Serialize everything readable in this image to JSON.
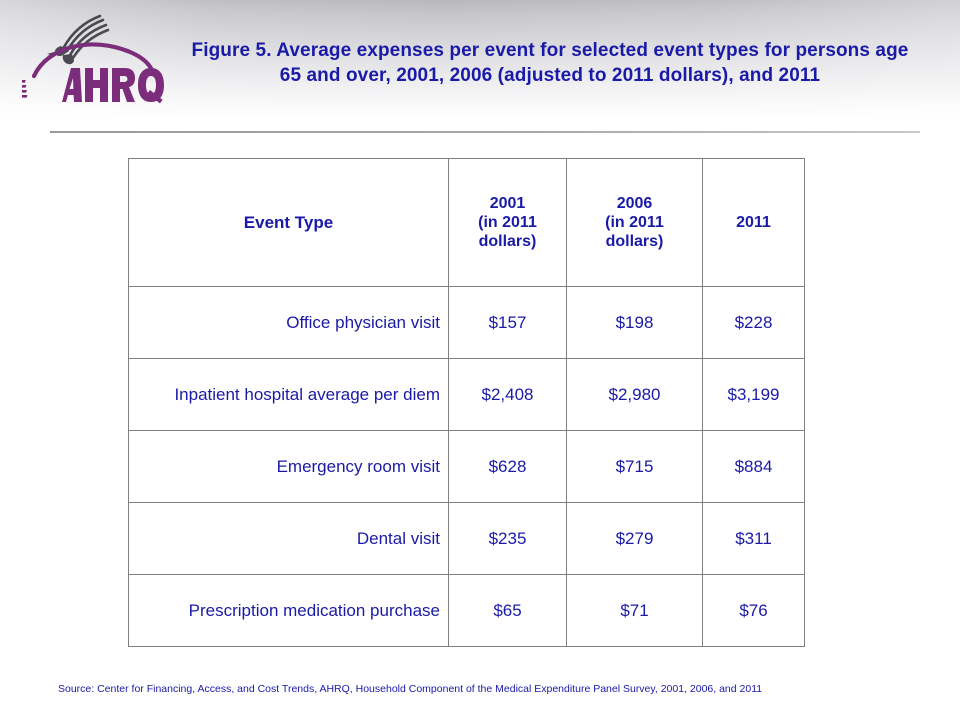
{
  "slide": {
    "title": "Figure 5. Average expenses per event for selected event types for persons age 65 and over, 2001, 2006 (adjusted to 2011 dollars), and 2011",
    "source": "Source: Center for Financing, Access, and Cost Trends, AHRQ, Household Component of the Medical Expenditure Panel Survey,  2001, 2006, and 2011",
    "colors": {
      "title_blue": "#1a1aa8",
      "logo_purple": "#7b2d7b",
      "eagle_gray": "#4a4a52",
      "table_border": "#808084",
      "header_band_top": "#b9b9bd"
    }
  },
  "logo": {
    "wordmark": "AHRQ",
    "eagle_name": "hhs-eagle-icon"
  },
  "chart_data": {
    "type": "table",
    "title": "Figure 5. Average expenses per event for selected event types for persons age 65 and over, 2001, 2006 (adjusted to 2011 dollars), and 2011",
    "columns": [
      "Event Type",
      "2001\n(in 2011 dollars)",
      "2006\n(in 2011 dollars)",
      "2011"
    ],
    "categories": [
      "Office physician visit",
      "Inpatient hospital average per diem",
      "Emergency room visit",
      "Dental visit",
      "Prescription medication purchase"
    ],
    "series": [
      {
        "name": "2001 (in 2011 dollars)",
        "values": [
          157,
          2408,
          628,
          235,
          65
        ]
      },
      {
        "name": "2006 (in 2011 dollars)",
        "values": [
          198,
          2980,
          715,
          279,
          71
        ]
      },
      {
        "name": "2011",
        "values": [
          228,
          3199,
          884,
          311,
          76
        ]
      }
    ],
    "units": "US dollars per event",
    "xlabel": "",
    "ylabel": ""
  },
  "table": {
    "header": {
      "label": "Event Type",
      "c1_line1": "2001",
      "c1_line2": "(in 2011",
      "c1_line3": "dollars)",
      "c2_line1": "2006",
      "c2_line2": "(in 2011",
      "c2_line3": "dollars)",
      "c3": "2011"
    },
    "rows": [
      {
        "label": "Office physician visit",
        "v1": "$157",
        "v2": "$198",
        "v3": "$228"
      },
      {
        "label": "Inpatient hospital average per diem",
        "v1": "$2,408",
        "v2": "$2,980",
        "v3": "$3,199"
      },
      {
        "label": "Emergency room visit",
        "v1": "$628",
        "v2": "$715",
        "v3": "$884"
      },
      {
        "label": "Dental visit",
        "v1": "$235",
        "v2": "$279",
        "v3": "$311"
      },
      {
        "label": "Prescription medication purchase",
        "v1": "$65",
        "v2": "$71",
        "v3": "$76"
      }
    ]
  }
}
